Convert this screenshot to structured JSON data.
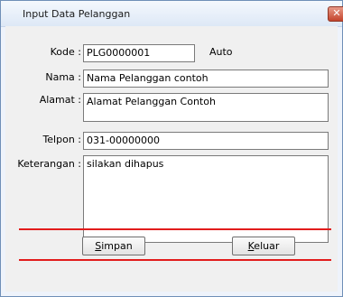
{
  "window": {
    "title": "Input Data Pelanggan",
    "close_glyph": "✕"
  },
  "form": {
    "kode": {
      "label": "Kode :",
      "value": "PLG0000001",
      "hint": "Auto"
    },
    "nama": {
      "label": "Nama :",
      "value": "Nama Pelanggan contoh"
    },
    "alamat": {
      "label": "Alamat :",
      "value": "Alamat Pelanggan Contoh"
    },
    "telpon": {
      "label": "Telpon :",
      "value": "031-00000000"
    },
    "keterangan": {
      "label": "Keterangan :",
      "value": "silakan dihapus"
    }
  },
  "buttons": {
    "simpan": {
      "accel": "S",
      "rest": "impan"
    },
    "keluar": {
      "accel": "K",
      "rest": "eluar"
    }
  },
  "colors": {
    "divider": "#e21c1c",
    "window_border": "#6f8fb7"
  }
}
